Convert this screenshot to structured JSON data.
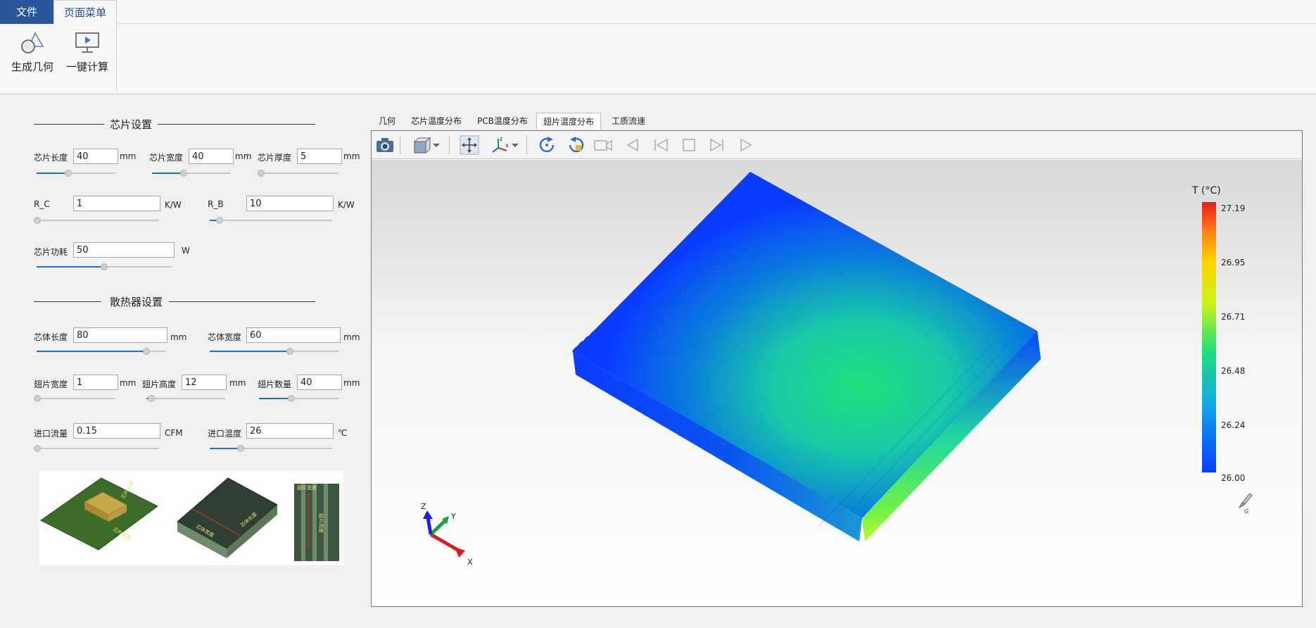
{
  "ribbon": {
    "tabs": [
      "文件",
      "页面菜单"
    ],
    "buttons": [
      "生成几何",
      "一键计算"
    ]
  },
  "chip_section": {
    "title": "芯片设置",
    "chip_length": {
      "label": "芯片长度",
      "value": "40",
      "unit": "mm"
    },
    "chip_width": {
      "label": "芯片宽度",
      "value": "40",
      "unit": "mm"
    },
    "chip_thickness": {
      "label": "芯片厚度",
      "value": "5",
      "unit": "mm"
    },
    "r_c": {
      "label": "R_C",
      "value": "1",
      "unit": "K/W"
    },
    "r_b": {
      "label": "R_B",
      "value": "10",
      "unit": "K/W"
    },
    "chip_power": {
      "label": "芯片功耗",
      "value": "50",
      "unit": "W"
    }
  },
  "sink_section": {
    "title": "散热器设置",
    "body_length": {
      "label": "芯体长度",
      "value": "80",
      "unit": "mm"
    },
    "body_width": {
      "label": "芯体宽度",
      "value": "60",
      "unit": "mm"
    },
    "fin_width": {
      "label": "翅片宽度",
      "value": "1",
      "unit": "mm"
    },
    "fin_height": {
      "label": "翅片高度",
      "value": "12",
      "unit": "mm"
    },
    "fin_count": {
      "label": "翅片数量",
      "value": "40",
      "unit": "mm"
    },
    "inlet_flow": {
      "label": "进口流量",
      "value": "0.15",
      "unit": "CFM"
    },
    "inlet_temp": {
      "label": "进口温度",
      "value": "26",
      "unit": "℃"
    }
  },
  "sliders": {
    "chip_length": 0.4,
    "chip_width": 0.4,
    "chip_thickness": 0.0,
    "r_c": 0.0,
    "r_b": 0.08,
    "chip_power": 0.5,
    "body_length": 0.85,
    "body_width": 0.62,
    "fin_width": 0.0,
    "fin_height": 0.06,
    "fin_count": 0.4,
    "inlet_flow": 0.0,
    "inlet_temp": 0.25
  },
  "diagram_labels": [
    "芯片宽度",
    "芯片长度",
    "芯体宽度",
    "芯体长度",
    "翅片宽度",
    "翅片高度"
  ],
  "viewer": {
    "tabs": [
      "几何",
      "芯片温度分布",
      "PCB温度分布",
      "翅片温度分布",
      "工质流速"
    ],
    "active_tab": "翅片温度分布",
    "toolbar_icons": [
      "camera-icon",
      "cube-view-icon",
      "dropdown-icon",
      "fit-view-icon",
      "axes-icon",
      "dropdown-icon",
      "rotate-cw-icon",
      "rotate-ccw-icon",
      "video-icon",
      "prev-icon",
      "first-frame-icon",
      "stop-icon",
      "last-frame-icon",
      "play-icon"
    ],
    "axes": {
      "x": "X",
      "y": "Y",
      "z": "Z"
    },
    "legend": {
      "title": "T (°C)",
      "ticks": [
        "27.19",
        "26.95",
        "26.71",
        "26.48",
        "26.24",
        "26.00"
      ]
    },
    "colors": {
      "min": "#0a3cff",
      "mid": "#1fe07a",
      "max": "#e81a1a"
    }
  }
}
